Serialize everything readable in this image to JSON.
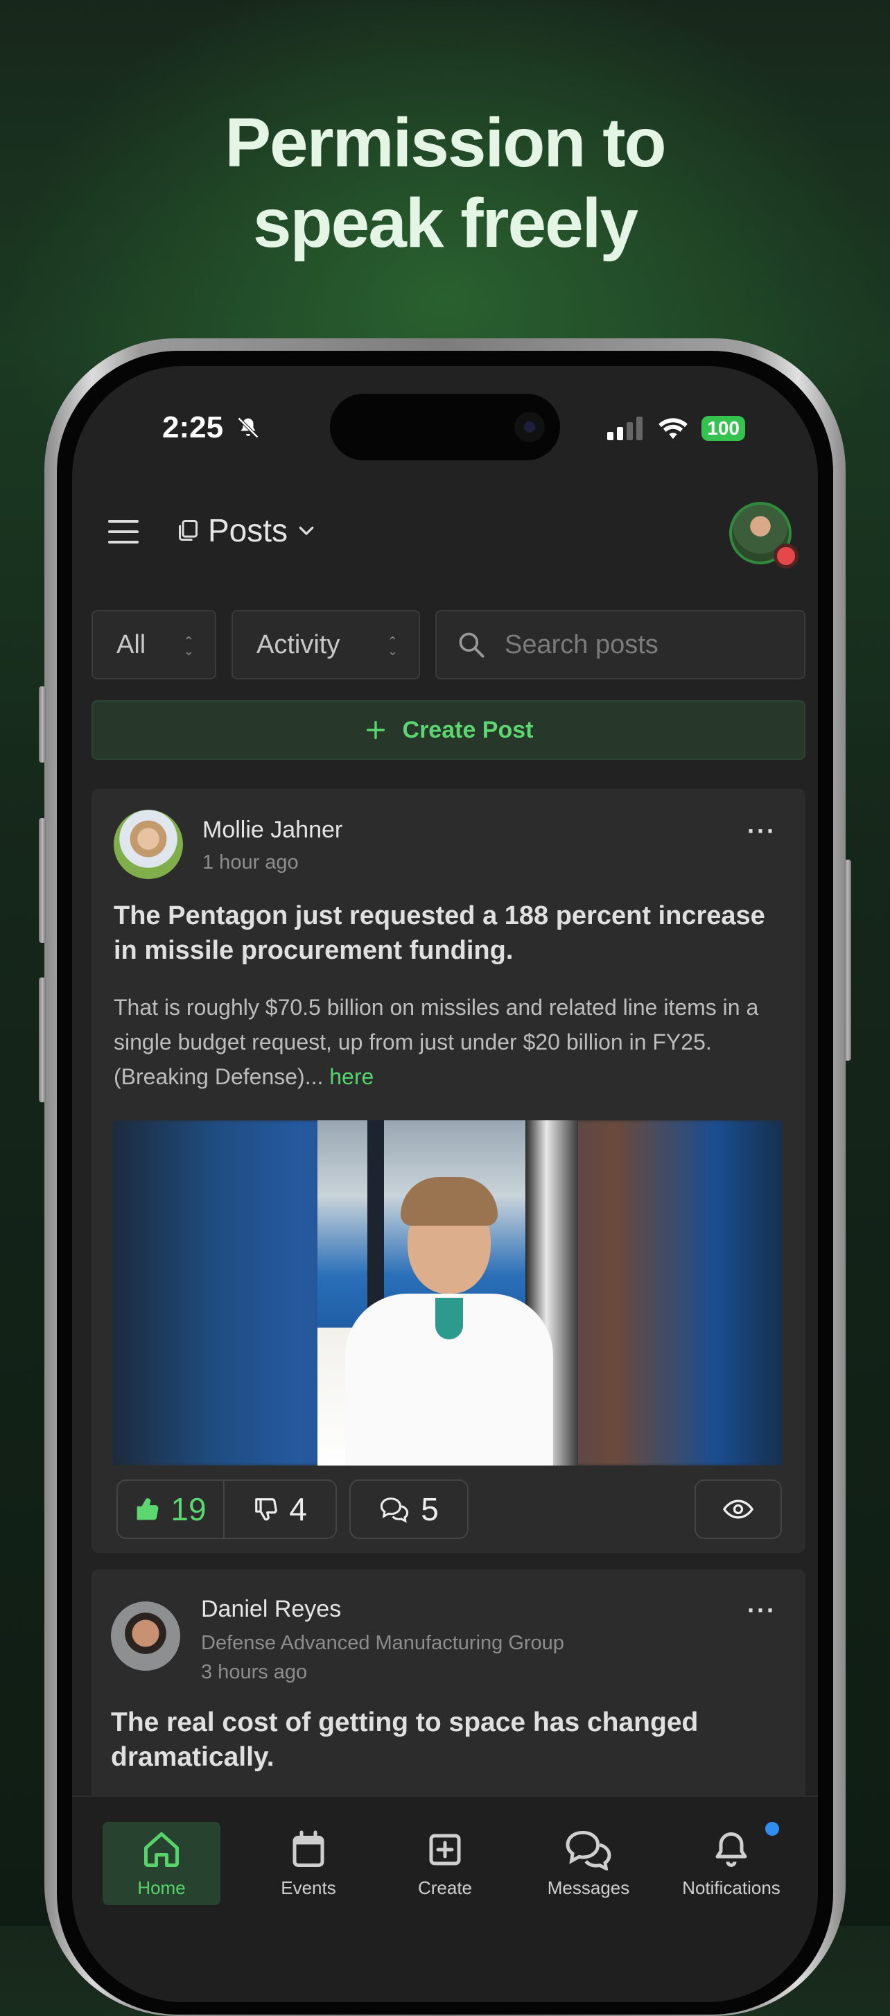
{
  "headline": {
    "line1": "Permission to",
    "line2": "speak freely"
  },
  "status": {
    "time": "2:25",
    "battery": "100"
  },
  "topbar": {
    "section_label": "Posts"
  },
  "filters": {
    "scope": "All",
    "sort": "Activity",
    "search_placeholder": "Search posts"
  },
  "create_button": {
    "label": "Create Post"
  },
  "posts": [
    {
      "author": "Mollie Jahner",
      "time": "1 hour ago",
      "title": "The Pentagon just requested a 188 percent increase in missile procurement funding.",
      "body": "That is roughly $70.5 billion on missiles and related line items in a single budget request, up from just under $20 billion in FY25. (Breaking Defense)...",
      "more_link": "here",
      "likes": "19",
      "dislikes": "4",
      "comments": "5"
    },
    {
      "author": "Daniel Reyes",
      "org": "Defense Advanced Manufacturing Group",
      "time": "3 hours ago",
      "title": "The real cost of getting to space has changed dramatically."
    }
  ],
  "nav": {
    "home": "Home",
    "events": "Events",
    "create": "Create",
    "messages": "Messages",
    "notifications": "Notifications"
  },
  "colors": {
    "accent": "#54d46c",
    "background": "#222222",
    "card": "#2c2c2c",
    "alert": "#e54848"
  }
}
